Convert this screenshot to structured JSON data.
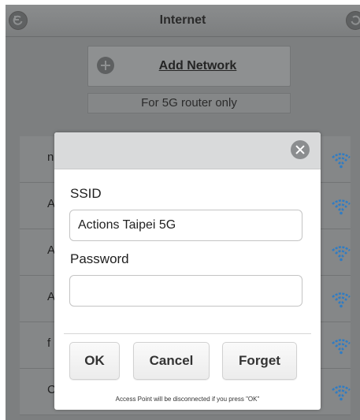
{
  "header": {
    "title": "Internet",
    "back_icon": "back-arrow-icon",
    "refresh_icon": "refresh-icon"
  },
  "add_network": {
    "label": "Add Network",
    "icon": "plus-icon"
  },
  "router_note": "For 5G router only",
  "networks": [
    {
      "peek": "n"
    },
    {
      "peek": "A"
    },
    {
      "peek": "A"
    },
    {
      "peek": "A"
    },
    {
      "peek": "f"
    },
    {
      "peek": "C"
    }
  ],
  "dialog": {
    "ssid_label": "SSID",
    "ssid_value": "Actions Taipei 5G",
    "password_label": "Password",
    "password_value": "",
    "ok_label": "OK",
    "cancel_label": "Cancel",
    "forget_label": "Forget",
    "notice": "Access Point will be disconnected if you press \"OK\""
  },
  "colors": {
    "wifi_icon": "#2f7cc4",
    "dim_overlay": "#7d7f80",
    "dialog_bg": "#ffffff"
  }
}
